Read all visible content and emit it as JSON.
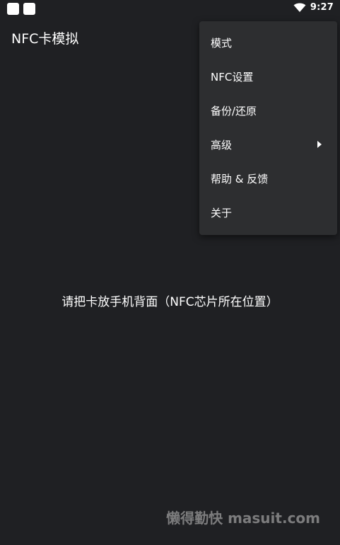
{
  "status_bar": {
    "time": "9:27",
    "left_icons": [
      "notification-icon",
      "notification-icon"
    ],
    "right_icons": [
      "wifi-icon"
    ]
  },
  "app": {
    "title": "NFC卡模拟"
  },
  "menu": {
    "items": [
      {
        "label": "模式",
        "has_submenu": false
      },
      {
        "label": "NFC设置",
        "has_submenu": false
      },
      {
        "label": "备份/还原",
        "has_submenu": false
      },
      {
        "label": "高级",
        "has_submenu": true
      },
      {
        "label": "帮助 & 反馈",
        "has_submenu": false
      },
      {
        "label": "关于",
        "has_submenu": false
      }
    ]
  },
  "main": {
    "message": "请把卡放手机背面（NFC芯片所在位置）"
  },
  "watermark": {
    "text": "懒得勤快  masuit.com"
  },
  "colors": {
    "background": "#1f2023",
    "menu_background": "#2d2e30",
    "text": "#ffffff"
  }
}
